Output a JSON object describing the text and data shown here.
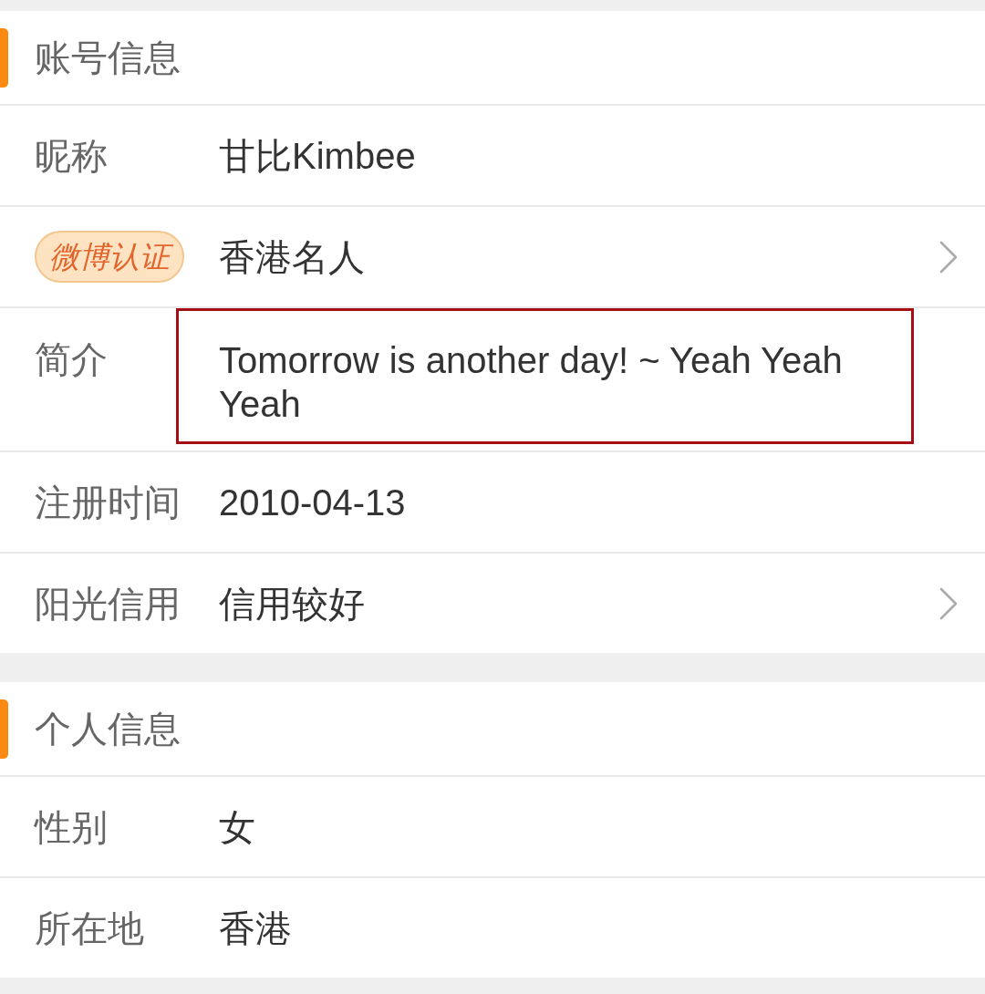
{
  "sections": [
    {
      "title": "账号信息",
      "rows": [
        {
          "kind": "text",
          "label": "昵称",
          "value": "甘比Kimbee",
          "has_arrow": false,
          "highlighted": false
        },
        {
          "kind": "badge",
          "label": "微博认证",
          "value": "香港名人",
          "has_arrow": true,
          "highlighted": false
        },
        {
          "kind": "text",
          "label": "简介",
          "value": "Tomorrow is another day! ~ Yeah Yeah Yeah",
          "has_arrow": false,
          "highlighted": true
        },
        {
          "kind": "text",
          "label": "注册时间",
          "value": "2010-04-13",
          "has_arrow": false,
          "highlighted": false
        },
        {
          "kind": "text",
          "label": "阳光信用",
          "value": "信用较好",
          "has_arrow": true,
          "highlighted": false
        }
      ]
    },
    {
      "title": "个人信息",
      "rows": [
        {
          "kind": "text",
          "label": "性别",
          "value": "女",
          "has_arrow": false,
          "highlighted": false
        },
        {
          "kind": "text",
          "label": "所在地",
          "value": "香港",
          "has_arrow": false,
          "highlighted": false
        }
      ]
    }
  ]
}
